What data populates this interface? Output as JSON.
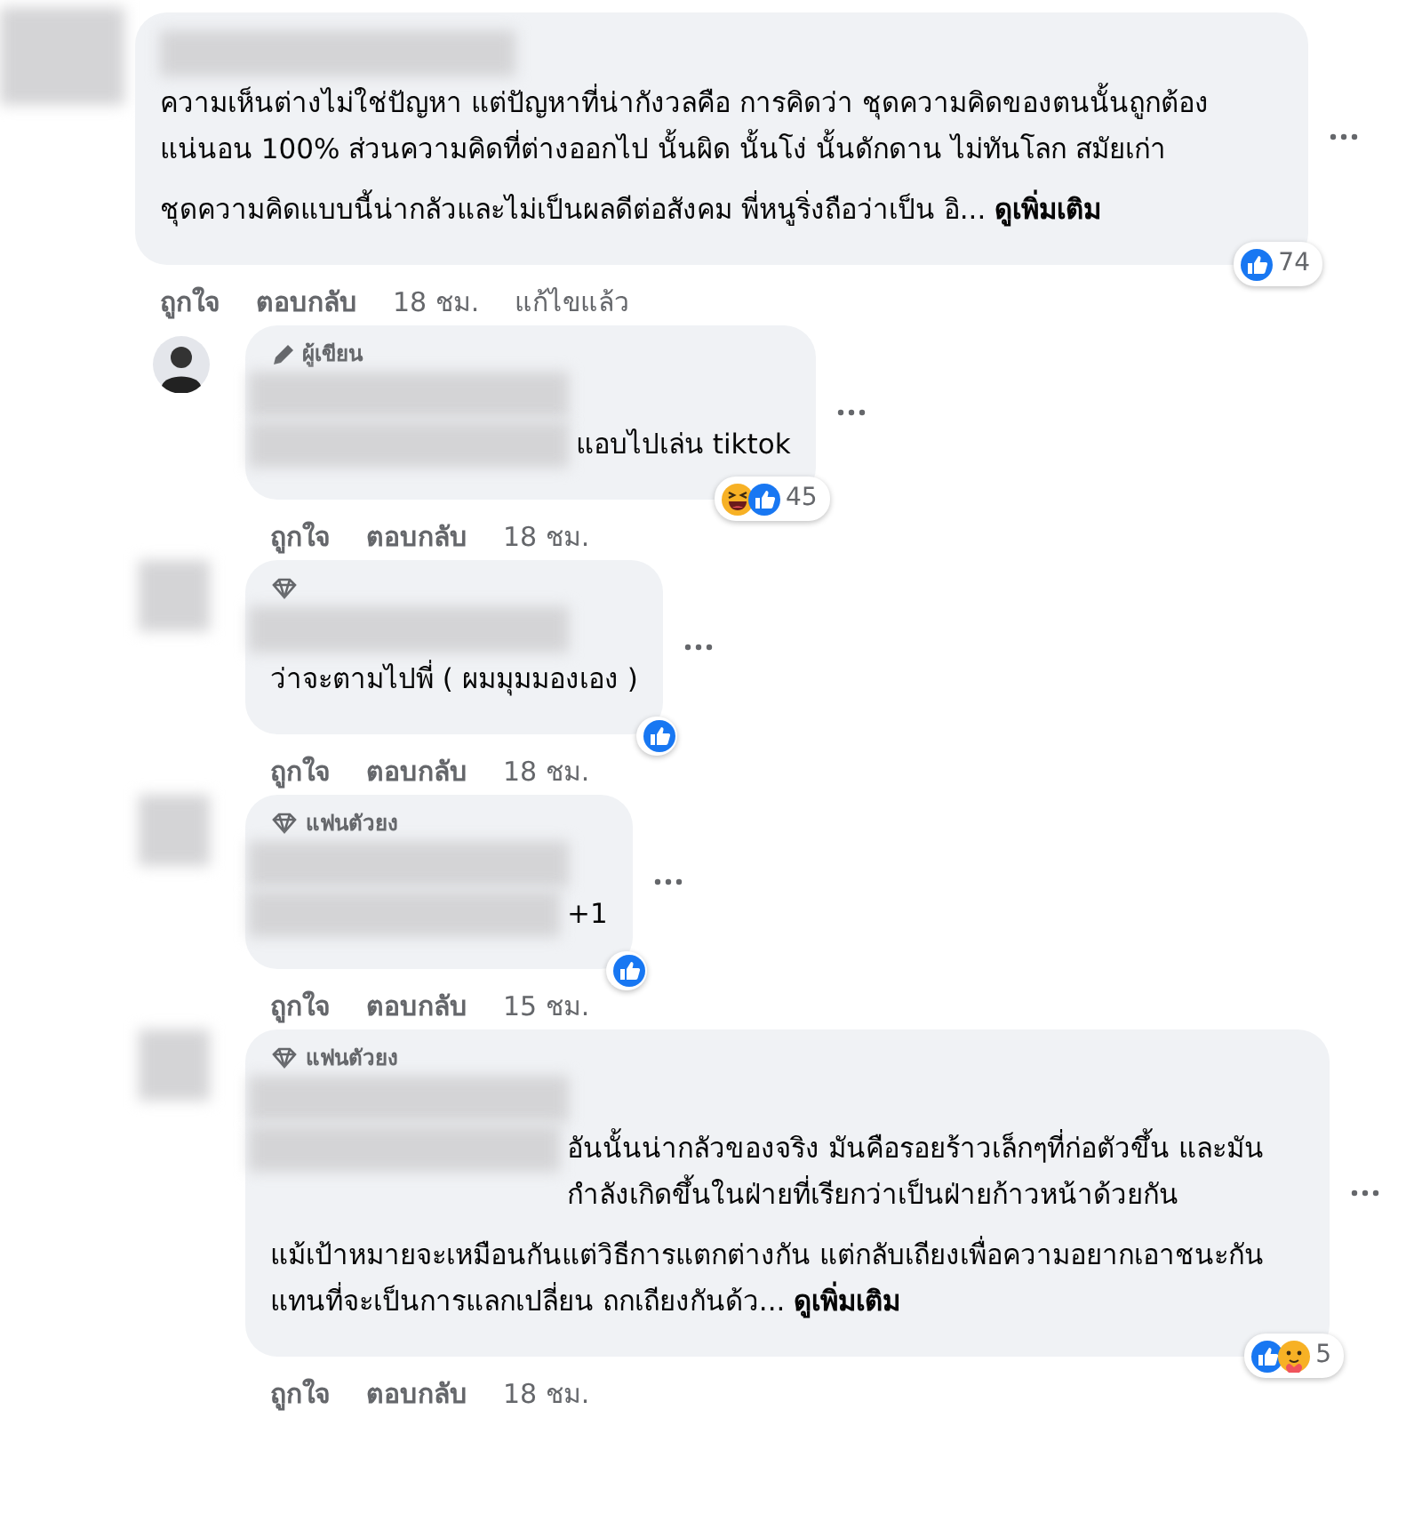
{
  "comments": [
    {
      "reply": false,
      "avatar": {
        "kind": "blurred"
      },
      "paragraphs": [
        "ความเห็นต่างไม่ใช่ปัญหา แต่ปัญหาที่น่ากังวลคือ การคิดว่า ชุดความคิดของตนนั้นถูกต้องแน่นอน 100% ส่วนความคิดที่ต่างออกไป นั้นผิด นั้นโง่ นั้นดักดาน ไม่ทันโลก สมัยเก่า",
        "ชุดความคิดแบบนี้น่ากลัวและไม่เป็นผลดีต่อสังคม พี่หนูริ่งถือว่าเป็น อิ..."
      ],
      "see_more": "ดูเพิ่มเติม",
      "reactions": [
        {
          "kind": "like"
        }
      ],
      "reaction_count": "74",
      "actions": [
        {
          "kind": "link",
          "label": "ถูกใจ"
        },
        {
          "kind": "link",
          "label": "ตอบกลับ"
        },
        {
          "kind": "time",
          "label": "18 ชม."
        },
        {
          "kind": "note",
          "label": "แก้ไขแล้ว"
        }
      ]
    },
    {
      "reply": true,
      "avatar": {
        "kind": "photo"
      },
      "badge": {
        "kind": "author",
        "label": "ผู้เขียน"
      },
      "paragraphs": [
        "แอบไปเล่น tiktok"
      ],
      "reactions": [
        {
          "kind": "haha"
        },
        {
          "kind": "like"
        }
      ],
      "reaction_count": "45",
      "actions": [
        {
          "kind": "link",
          "label": "ถูกใจ"
        },
        {
          "kind": "link",
          "label": "ตอบกลับ"
        },
        {
          "kind": "time",
          "label": "18 ชม."
        }
      ]
    },
    {
      "reply": true,
      "avatar": {
        "kind": "blurred"
      },
      "badge": {
        "kind": "fan"
      },
      "paragraphs": [
        "ว่าจะตามไปพี่ ( ผมมุมมองเอง )"
      ],
      "reactions": [
        {
          "kind": "like"
        }
      ],
      "actions": [
        {
          "kind": "link",
          "label": "ถูกใจ"
        },
        {
          "kind": "link",
          "label": "ตอบกลับ"
        },
        {
          "kind": "time",
          "label": "18 ชม."
        }
      ]
    },
    {
      "reply": true,
      "avatar": {
        "kind": "blurred"
      },
      "badge": {
        "kind": "fan",
        "label": "แฟนตัวยง"
      },
      "paragraphs": [
        "+1"
      ],
      "reactions": [
        {
          "kind": "like"
        }
      ],
      "actions": [
        {
          "kind": "link",
          "label": "ถูกใจ"
        },
        {
          "kind": "link",
          "label": "ตอบกลับ"
        },
        {
          "kind": "time",
          "label": "15 ชม."
        }
      ]
    },
    {
      "reply": true,
      "avatar": {
        "kind": "blurred"
      },
      "badge": {
        "kind": "fan",
        "label": "แฟนตัวยง"
      },
      "paragraphs": [
        "อันนั้นน่ากลัวของจริง มันคือรอยร้าวเล็กๆที่ก่อตัวขึ้น และมันกำลังเกิดขึ้นในฝ่ายที่เรียกว่าเป็นฝ่ายก้าวหน้าด้วยกัน",
        "แม้เป้าหมายจะเหมือนกันแต่วิธีการแตกต่างกัน แต่กลับเถียงเพื่อความอยากเอาชนะกัน แทนที่จะเป็นการแลกเปลี่ยน ถกเถียงกันด้ว..."
      ],
      "see_more": "ดูเพิ่มเติม",
      "reactions": [
        {
          "kind": "like"
        },
        {
          "kind": "care"
        }
      ],
      "reaction_count": "5",
      "actions": [
        {
          "kind": "link",
          "label": "ถูกใจ"
        },
        {
          "kind": "link",
          "label": "ตอบกลับ"
        },
        {
          "kind": "time",
          "label": "18 ชม."
        }
      ]
    }
  ]
}
